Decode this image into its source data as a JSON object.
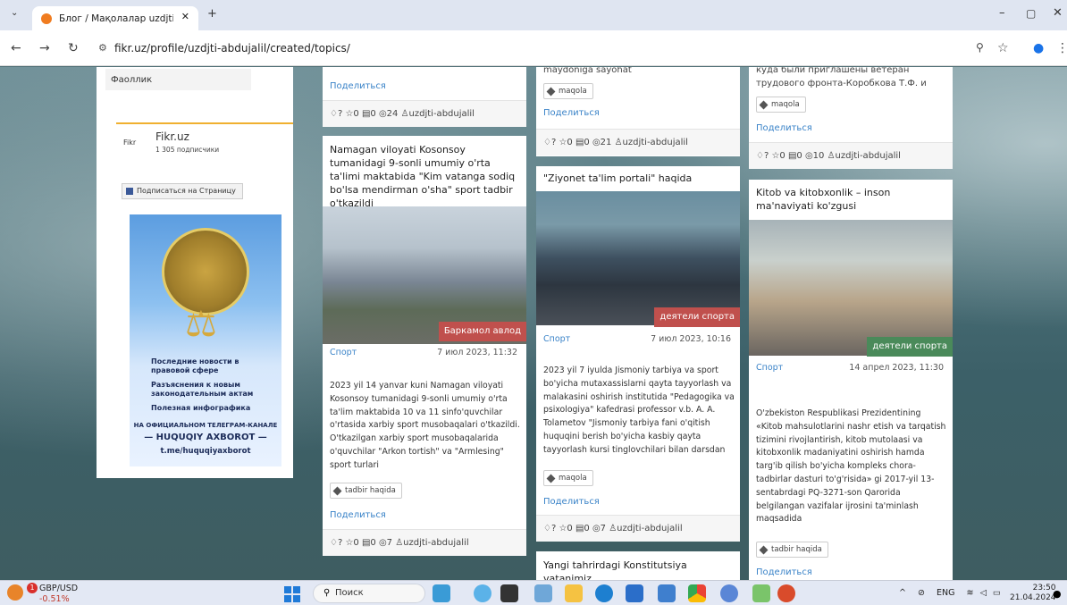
{
  "browser": {
    "tab_title": "Блог / Мақолалар uzdjti-abdu",
    "tab_close": "✕",
    "new_tab": "+",
    "url": "fikr.uz/profile/uzdjti-abdujalil/created/topics/"
  },
  "sidebar": {
    "faollik": "Фаоллик",
    "fb_name": "Fikr.uz",
    "fb_logo_text": "Fikr",
    "fb_subscribers": "1 305 подписчики",
    "fb_button": "Подписаться на Страницу",
    "ad": {
      "items": [
        "Последние новости в правовой сфере",
        "Разъяснения к новым законодательным актам",
        "Полезная инфографика"
      ],
      "tagline1": "НА ОФИЦИАЛЬНОМ ТЕЛЕГРАМ-КАНАЛЕ",
      "tagline2": "— HUQUQIY AXBOROT —",
      "link": "t.me/huquqiyaxborot"
    }
  },
  "col1": {
    "top_share": "Поделиться",
    "top_stats": "♢? ☆0 ▤0 ◎24 ♙uzdjti-abdujalil",
    "card": {
      "title": "Namagan viloyati Kosonsoy tumanidagi 9-sonli umumiy o'rta ta'limi maktabida \"Kim vatanga sodiq bo'lsa mendirman o'sha\" sport tadbir o'tkazildi",
      "tag": "Баркамол авлод",
      "category": "Спорт",
      "date": "7 июл 2023, 11:32",
      "body": "2023 yil 14 yanvar kuni Namagan viloyati Kosonsoy tumanidagi 9-sonli umumiy o'rta ta'lim maktabida 10 va 11 sinfo'quvchilar o'rtasida xarbiy sport musobaqalari o'tkazildi. O'tkazilgan xarbiy sport musobaqalarida o'quvchilar \"Arkon tortish\" va \"Armlesing\" sport turlari",
      "chip": "tadbir haqida",
      "share": "Поделиться",
      "stats": "♢? ☆0 ▤0 ◎7 ♙uzdjti-abdujalil"
    }
  },
  "col2": {
    "top_text": "maydoniga sayohat",
    "top_chip": "maqola",
    "top_share": "Поделиться",
    "top_stats": "♢? ☆0 ▤0 ◎21 ♙uzdjti-abdujalil",
    "card": {
      "title": "\"Ziyonet ta'lim portali\" haqida",
      "tag": "деятели спорта",
      "category": "Спорт",
      "date": "7 июл 2023, 10:16",
      "body": "2023 yil 7 iyulda Jismoniy tarbiya va sport bo'yicha mutaxassislarni qayta tayyorlash va malakasini oshirish institutida \"Pedagogika va psixologiya\" kafedrasi professor v.b. A. A. Tolametov \"Jismoniy tarbiya fani o'qitish huquqini berish bo'yicha kasbiy qayta tayyorlash kursi tinglovchilari bilan darsdan",
      "chip": "maqola",
      "share": "Поделиться",
      "stats": "♢? ☆0 ▤0 ◎7 ♙uzdjti-abdujalil"
    },
    "next_title": "Yangi tahrirdagi Konstitutsiya vatanimiz"
  },
  "col3": {
    "top_text": "куда были приглашены ветеран трудового фронта-Коробкова Т.Ф. и",
    "top_chip": "maqola",
    "top_share": "Поделиться",
    "top_stats": "♢? ☆0 ▤0 ◎10 ♙uzdjti-abdujalil",
    "card": {
      "title": "Kitob va kitobxonlik – inson ma'naviyati ko'zgusi",
      "tag": "деятели спорта",
      "category": "Спорт",
      "date": "14 апрел 2023, 11:30",
      "body": "O'zbekiston Respublikasi Prezidentining «Kitob mahsulotlarini nashr etish va tarqatish tizimini rivojlantirish, kitob mutolaasi va kitobxonlik madaniyatini oshirish hamda targ'ib qilish bo'yicha kompleks chora-tadbirlar dasturi to'g'risida» gi 2017-yil 13-sentabrdagi PQ-3271-son Qarorida belgilangan vazifalar ijrosini ta'minlash maqsadida",
      "chip": "tadbir haqida",
      "share": "Поделиться"
    }
  },
  "taskbar": {
    "weather_title": "GBP/USD",
    "weather_value": "-0.51%",
    "badge": "1",
    "search": "Поиск",
    "lang": "ENG",
    "time": "23:50",
    "date": "21.04.2024"
  }
}
